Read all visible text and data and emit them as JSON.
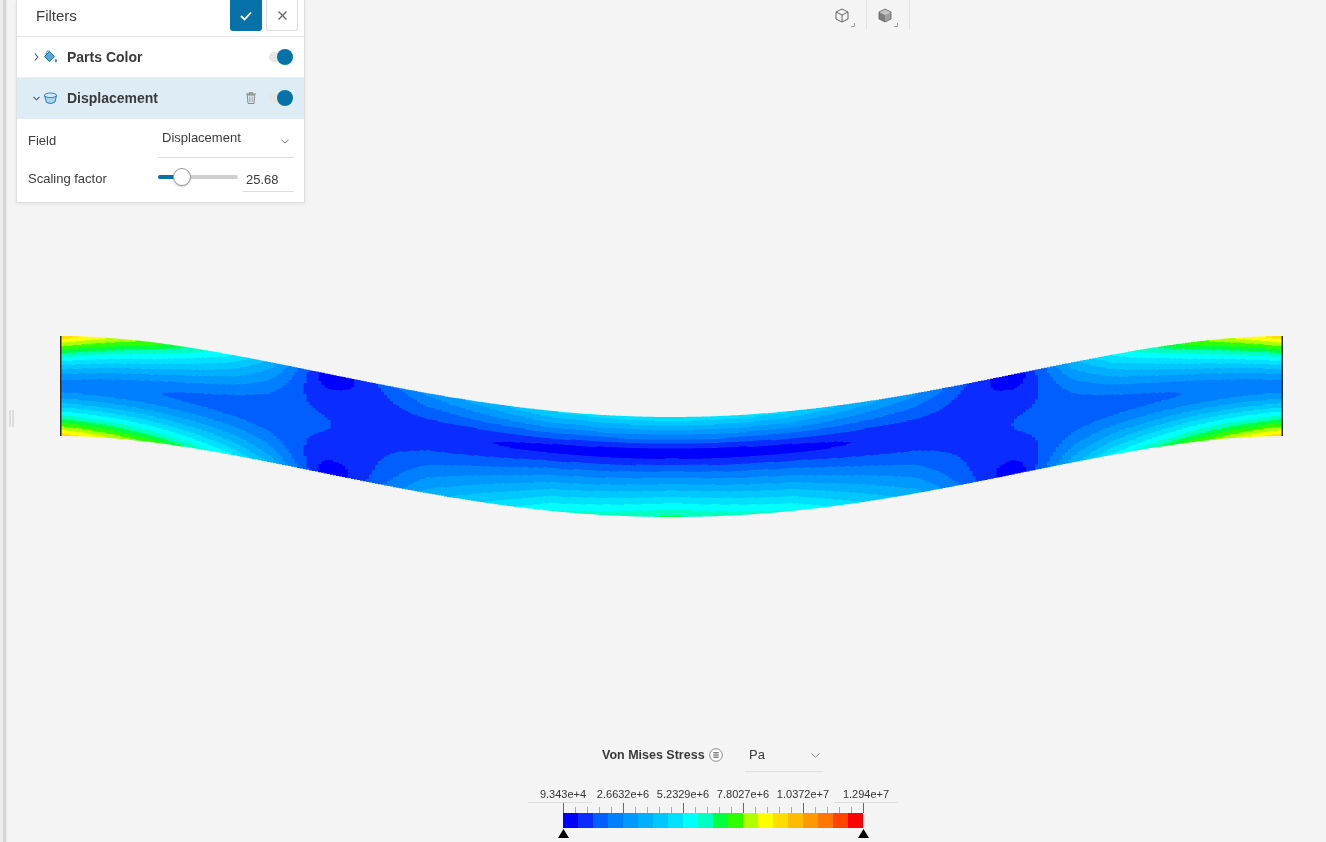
{
  "filters_panel": {
    "title": "Filters",
    "filters": [
      {
        "kind": "parts-color",
        "label": "Parts Color",
        "expanded": false,
        "selected": false,
        "enabled": true
      },
      {
        "kind": "displacement",
        "label": "Displacement",
        "expanded": true,
        "selected": true,
        "enabled": true,
        "field": {
          "label": "Field",
          "value": "Displacement"
        },
        "scaling_factor": {
          "label": "Scaling factor",
          "level": 0.3,
          "value": "25.68"
        }
      }
    ]
  },
  "legend": {
    "title": "Von Mises Stress",
    "unit": "Pa",
    "min_value": "9.343e+4",
    "max_value": "1.294e+7",
    "tick_labels": [
      "2.6632e+6",
      "5.2329e+6",
      "7.8027e+6",
      "1.0372e+7"
    ]
  }
}
